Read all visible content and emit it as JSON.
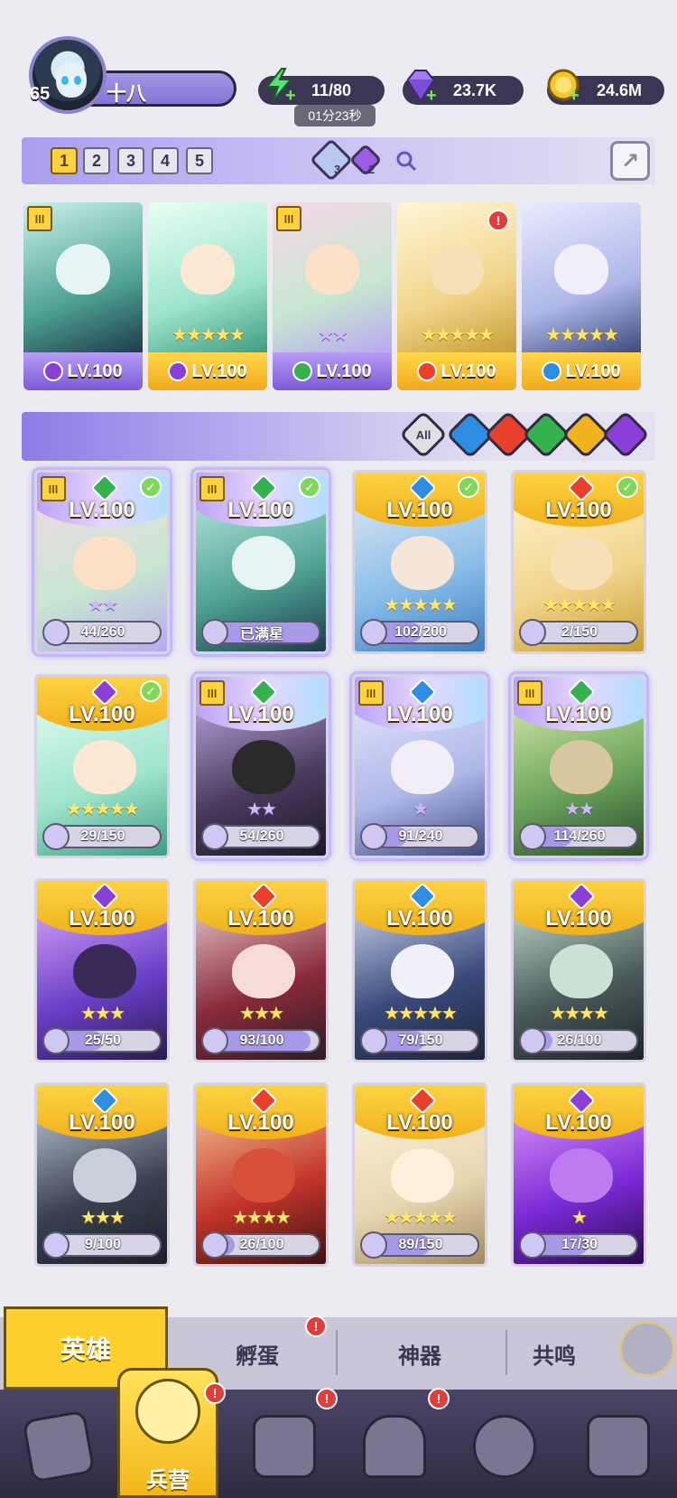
{
  "player": {
    "level": "65",
    "name": "十八"
  },
  "resources": {
    "energy": "11/80",
    "energy_timer": "01分23秒",
    "gems": "23.7K",
    "coins": "24.6M"
  },
  "team_tabs": [
    "1",
    "2",
    "3",
    "4",
    "5"
  ],
  "active_team": "1",
  "team_gems": {
    "blue_count": "3",
    "purple_count": "2"
  },
  "team_cards": [
    {
      "level": "LV.100",
      "element": "dark",
      "stars": "",
      "footer": "purple",
      "tier": "III",
      "alert": false
    },
    {
      "level": "LV.100",
      "element": "dark",
      "stars": "★★★★★",
      "footer": "gold",
      "tier": "",
      "alert": false
    },
    {
      "level": "LV.100",
      "element": "wind",
      "stars": "★★",
      "footer": "purple",
      "tier": "III",
      "alert": false
    },
    {
      "level": "LV.100",
      "element": "fire",
      "stars": "★★★★★",
      "footer": "gold",
      "tier": "",
      "alert": true
    },
    {
      "level": "LV.100",
      "element": "water",
      "stars": "★★★★★",
      "footer": "gold",
      "tier": "",
      "alert": false
    }
  ],
  "filters": {
    "all_label": "All"
  },
  "heroes": [
    {
      "level": "LV.100",
      "element": "wind",
      "shards": "44/260",
      "fill": 0.17,
      "stars": "★★",
      "purple": true,
      "check": true,
      "tier": true,
      "sel": true,
      "bg": "pink"
    },
    {
      "level": "LV.100",
      "element": "wind",
      "shards": "已满星",
      "fill": 1.0,
      "stars": "",
      "purple": true,
      "check": true,
      "tier": true,
      "sel": true,
      "bg": "teal"
    },
    {
      "level": "LV.100",
      "element": "water",
      "shards": "102/200",
      "fill": 0.51,
      "stars": "★★★★★",
      "purple": false,
      "check": true,
      "tier": false,
      "sel": false,
      "bg": "blue"
    },
    {
      "level": "LV.100",
      "element": "fire",
      "shards": "2/150",
      "fill": 0.02,
      "stars": "★★★★★",
      "purple": false,
      "check": true,
      "tier": false,
      "sel": false,
      "bg": "gold"
    },
    {
      "level": "LV.100",
      "element": "dark",
      "shards": "29/150",
      "fill": 0.19,
      "stars": "★★★★★",
      "purple": false,
      "check": true,
      "tier": false,
      "sel": false,
      "bg": "mint"
    },
    {
      "level": "LV.100",
      "element": "wind",
      "shards": "54/260",
      "fill": 0.21,
      "stars": "★★",
      "purple": true,
      "check": false,
      "tier": true,
      "sel": true,
      "bg": "dark"
    },
    {
      "level": "LV.100",
      "element": "water",
      "shards": "91/240",
      "fill": 0.38,
      "stars": "★",
      "purple": true,
      "check": false,
      "tier": true,
      "sel": true,
      "bg": "ice"
    },
    {
      "level": "LV.100",
      "element": "wind",
      "shards": "114/260",
      "fill": 0.44,
      "stars": "★★",
      "purple": true,
      "check": false,
      "tier": true,
      "sel": true,
      "bg": "green"
    },
    {
      "level": "LV.100",
      "element": "dark",
      "shards": "25/50",
      "fill": 0.5,
      "stars": "★★★",
      "purple": false,
      "check": false,
      "tier": false,
      "sel": false,
      "bg": "violet"
    },
    {
      "level": "LV.100",
      "element": "fire",
      "shards": "93/100",
      "fill": 0.93,
      "stars": "★★★",
      "purple": false,
      "check": false,
      "tier": false,
      "sel": false,
      "bg": "crimson"
    },
    {
      "level": "LV.100",
      "element": "water",
      "shards": "79/150",
      "fill": 0.53,
      "stars": "★★★★★",
      "purple": false,
      "check": false,
      "tier": false,
      "sel": false,
      "bg": "navy"
    },
    {
      "level": "LV.100",
      "element": "dark",
      "shards": "26/100",
      "fill": 0.26,
      "stars": "★★★★",
      "purple": false,
      "check": false,
      "tier": false,
      "sel": false,
      "bg": "slate"
    },
    {
      "level": "LV.100",
      "element": "water",
      "shards": "9/100",
      "fill": 0.09,
      "stars": "★★★",
      "purple": false,
      "check": false,
      "tier": false,
      "sel": false,
      "bg": "charcoal"
    },
    {
      "level": "LV.100",
      "element": "fire",
      "shards": "26/100",
      "fill": 0.26,
      "stars": "★★★★",
      "purple": false,
      "check": false,
      "tier": false,
      "sel": false,
      "bg": "red"
    },
    {
      "level": "LV.100",
      "element": "fire",
      "shards": "89/150",
      "fill": 0.59,
      "stars": "★★★★★",
      "purple": false,
      "check": false,
      "tier": false,
      "sel": false,
      "bg": "cream"
    },
    {
      "level": "LV.100",
      "element": "dark",
      "shards": "17/30",
      "fill": 0.57,
      "stars": "★",
      "purple": false,
      "check": false,
      "tier": false,
      "sel": false,
      "bg": "purple"
    }
  ],
  "sub_tabs": {
    "heroes": "英雄",
    "hatch": "孵蛋",
    "artifacts": "神器",
    "resonance": "共鸣"
  },
  "nav": {
    "barracks": "兵营"
  },
  "colors": {
    "fire": "#e8402c",
    "water": "#2d8ee3",
    "wind": "#34b24f",
    "dark": "#8b3fd6",
    "light": "#f0b21d",
    "accent_gold": "#ffcf2e",
    "accent_purple": "#8c7ce6"
  },
  "icons": {
    "energy": "lightning-icon",
    "gems": "diamond-icon",
    "coins": "coin-icon",
    "share": "share-icon",
    "search": "search-icon"
  }
}
